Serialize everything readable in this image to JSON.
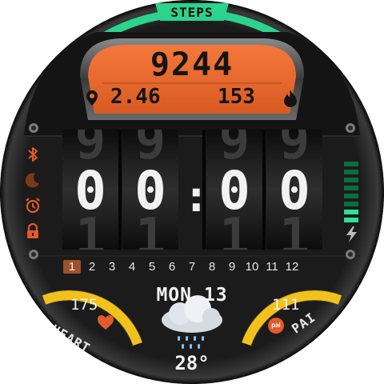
{
  "steps": {
    "title": "STEPS",
    "value": "9244",
    "progress_fraction": 0.82
  },
  "distance": {
    "value": "2.46",
    "icon": "location-pin-icon"
  },
  "calories": {
    "value": "153",
    "icon": "flame-icon"
  },
  "time": {
    "digits": [
      "0",
      "0",
      "0",
      "0"
    ],
    "ghost_above": [
      "9",
      "9",
      "9",
      "9"
    ],
    "ghost_below": [
      "1",
      "1",
      "1",
      "1"
    ],
    "separator": ":"
  },
  "status_icons": [
    "bluetooth-icon",
    "moon-icon",
    "alarm-clock-icon",
    "lock-icon"
  ],
  "battery": {
    "total_segments": 8,
    "filled_segments": 8,
    "icon": "lightning-icon"
  },
  "months": {
    "labels": [
      "1",
      "2",
      "3",
      "4",
      "5",
      "6",
      "7",
      "8",
      "9",
      "10",
      "11",
      "12"
    ],
    "active_index": 0
  },
  "date": {
    "text": "MON 13"
  },
  "weather": {
    "icon": "rain-cloud-icon",
    "temperature": "28°"
  },
  "heart": {
    "label": "HEART",
    "value": "175",
    "icon": "heart-icon"
  },
  "pai": {
    "label": "PAI",
    "value": "111",
    "badge": "pai"
  },
  "colors": {
    "steps_arc": "#2bd38d",
    "panel_orange": "#ec6a30",
    "gauge_yellow": "#f2c21a",
    "accent_orange": "#e25b2a",
    "battery_dark": "#0f6b45",
    "battery_light": "#2ee09a"
  }
}
